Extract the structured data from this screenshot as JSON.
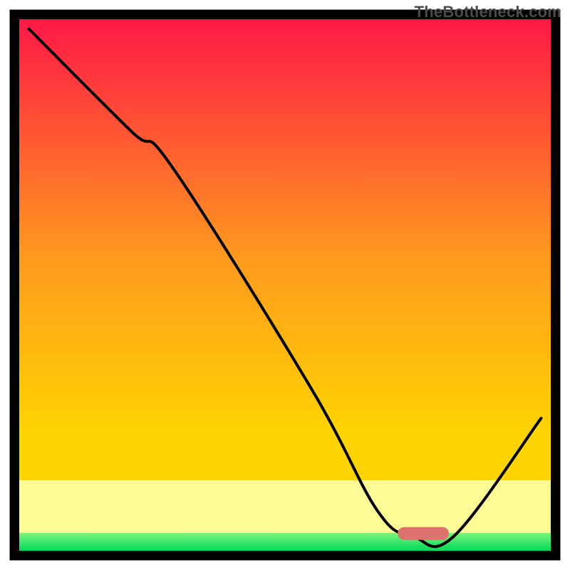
{
  "watermark": "TheBottleneck.com",
  "colors": {
    "frame": "#000000",
    "top_gradient": "#ff1846",
    "mid_gradient": "#ffd400",
    "paleband": "#ffff9e",
    "line": "#000000",
    "rounded_bar": "#e0726e",
    "green_top": "#7cf57c",
    "green_bottom": "#00d85a"
  },
  "chart_data": {
    "type": "line",
    "title": "",
    "xlabel": "",
    "ylabel": "",
    "xlim": [
      0,
      100
    ],
    "ylim": [
      0,
      100
    ],
    "x": [
      0,
      20,
      28,
      55,
      68,
      75,
      83,
      100
    ],
    "values": [
      100,
      80,
      73,
      30,
      6,
      1,
      1,
      24
    ],
    "annotations": {
      "flat_bar_x_range": [
        72,
        82
      ],
      "flat_bar_y": 1.5
    }
  }
}
